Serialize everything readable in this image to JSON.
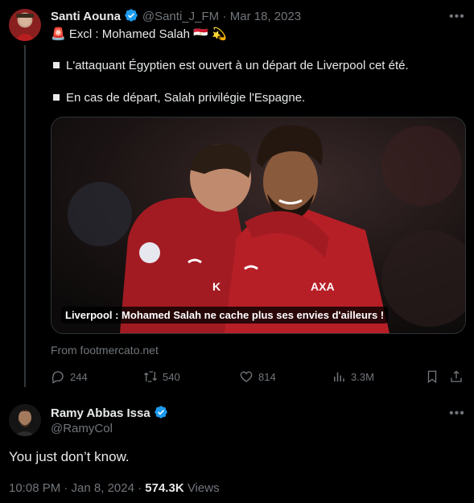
{
  "quoted_tweet": {
    "author_name": "Santi Aouna",
    "handle": "@Santi_J_FM",
    "date": "· Mar 18, 2023",
    "headline_prefix_emoji": "🚨",
    "headline": "Excl : Mohamed Salah",
    "headline_suffix_emojis": "🇪🇬 💫",
    "bullet_1": "L'attaquant Égyptien est ouvert à un départ de Liverpool cet été.",
    "bullet_2": "En cas de départ, Salah privilégie l'Espagne.",
    "media_caption": "Liverpool : Mohamed Salah ne cache plus ses envies d'ailleurs !",
    "link_source": "From footmercato.net",
    "replies": "244",
    "retweets": "540",
    "likes": "814",
    "views": "3.3M",
    "verified_color": "#1d9bf0"
  },
  "reply_tweet": {
    "author_name": "Ramy Abbas Issa",
    "handle": "@RamyCol",
    "text": "You just don’t know.",
    "time": "10:08 PM · Jan 8, 2024 ·",
    "views_count": "574.3K",
    "views_label": "Views"
  },
  "icons": [
    "reply-icon",
    "retweet-icon",
    "like-icon",
    "views-icon",
    "bookmark-icon",
    "share-icon",
    "more-icon",
    "verified-icon"
  ]
}
